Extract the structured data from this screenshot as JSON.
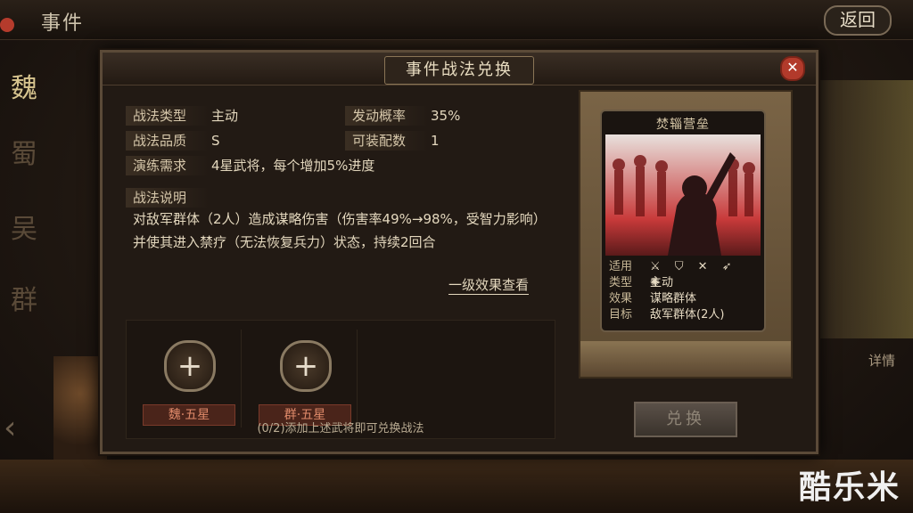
{
  "topbar": {
    "title": "事件",
    "back": "返回"
  },
  "factions": [
    "魏",
    "蜀",
    "吴",
    "群"
  ],
  "side": {
    "detail": "详情"
  },
  "watermark": "酷乐米",
  "dialog": {
    "title": "事件战法兑换",
    "close": "✕",
    "rows": [
      {
        "label1": "战法类型",
        "value1": "主动",
        "label2": "发动概率",
        "value2": "35%"
      },
      {
        "label1": "战法品质",
        "value1": "S",
        "label2": "可装配数",
        "value2": "1"
      }
    ],
    "training": {
      "label": "演练需求",
      "value": "4星武将，每个增加5%进度"
    },
    "description": {
      "label": "战法说明",
      "text": "对敌军群体（2人）造成谋略伤害（伤害率49%→98%，受智力影响）并使其进入禁疗（无法恢复兵力）状态，持续2回合"
    },
    "effect_link": "一级效果查看",
    "slots": [
      {
        "label": "魏·五星"
      },
      {
        "label": "群·五星"
      }
    ],
    "hint": "(0/2)添加上述武将即可兑换战法",
    "exchange": "兑换"
  },
  "card": {
    "title": "焚辎营垒",
    "attributes": [
      {
        "key": "适用",
        "value": "⚔ ⛉ ✕ ➶ ✺"
      },
      {
        "key": "类型",
        "value": "主动"
      },
      {
        "key": "效果",
        "value": "谋略群体"
      },
      {
        "key": "目标",
        "value": "敌军群体(2人)"
      }
    ]
  }
}
